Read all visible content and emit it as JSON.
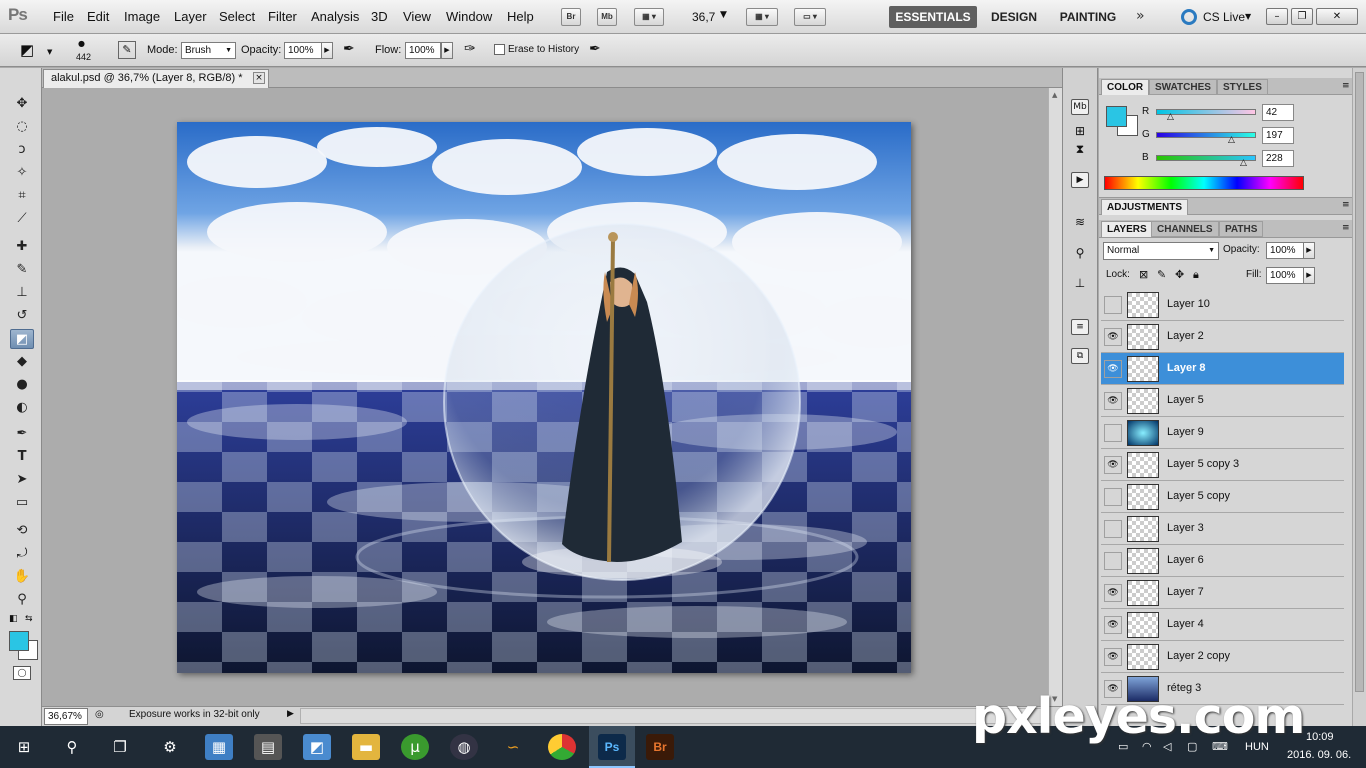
{
  "app": {
    "logo": "Ps"
  },
  "menu": [
    "File",
    "Edit",
    "Image",
    "Layer",
    "Select",
    "Filter",
    "Analysis",
    "3D",
    "View",
    "Window",
    "Help"
  ],
  "menubar": {
    "br_label": "Br",
    "mb_label": "Mb",
    "zoom_value": "36,7"
  },
  "workspaces": {
    "essentials": "ESSENTIALS",
    "design": "DESIGN",
    "painting": "PAINTING",
    "cs_live": "CS Live"
  },
  "options": {
    "brush_size": "442",
    "mode_label": "Mode:",
    "mode_value": "Brush",
    "opacity_label": "Opacity:",
    "opacity_value": "100%",
    "flow_label": "Flow:",
    "flow_value": "100%",
    "erase_history": "Erase to History"
  },
  "document": {
    "tab_title": "alakul.psd @ 36,7% (Layer 8, RGB/8) *",
    "close": "×"
  },
  "status": {
    "zoom": "36,67%",
    "message": "Exposure works in 32-bit only"
  },
  "color_panel": {
    "tabs": [
      "COLOR",
      "SWATCHES",
      "STYLES"
    ],
    "r_label": "R",
    "r_value": "42",
    "g_label": "G",
    "g_value": "197",
    "b_label": "B",
    "b_value": "228",
    "foreground": "#2ac5e4"
  },
  "adjustments_panel": {
    "title": "ADJUSTMENTS"
  },
  "layers_panel": {
    "tabs": [
      "LAYERS",
      "CHANNELS",
      "PATHS"
    ],
    "blend_mode": "Normal",
    "opacity_label": "Opacity:",
    "opacity_value": "100%",
    "lock_label": "Lock:",
    "fill_label": "Fill:",
    "fill_value": "100%",
    "layers": [
      {
        "name": "Layer 10",
        "visible": false
      },
      {
        "name": "Layer 2",
        "visible": true
      },
      {
        "name": "Layer 8",
        "visible": true,
        "selected": true
      },
      {
        "name": "Layer 5",
        "visible": true
      },
      {
        "name": "Layer 9",
        "visible": false
      },
      {
        "name": "Layer 5 copy 3",
        "visible": true
      },
      {
        "name": "Layer 5 copy",
        "visible": false
      },
      {
        "name": "Layer 3",
        "visible": false
      },
      {
        "name": "Layer 6",
        "visible": false
      },
      {
        "name": "Layer 7",
        "visible": true
      },
      {
        "name": "Layer 4",
        "visible": true
      },
      {
        "name": "Layer 2 copy",
        "visible": true
      },
      {
        "name": "réteg 3",
        "visible": true
      }
    ]
  },
  "taskbar": {
    "time": "10:09",
    "date": "2016. 09. 06.",
    "language": "HUN"
  },
  "watermark": "pxleyes.com"
}
